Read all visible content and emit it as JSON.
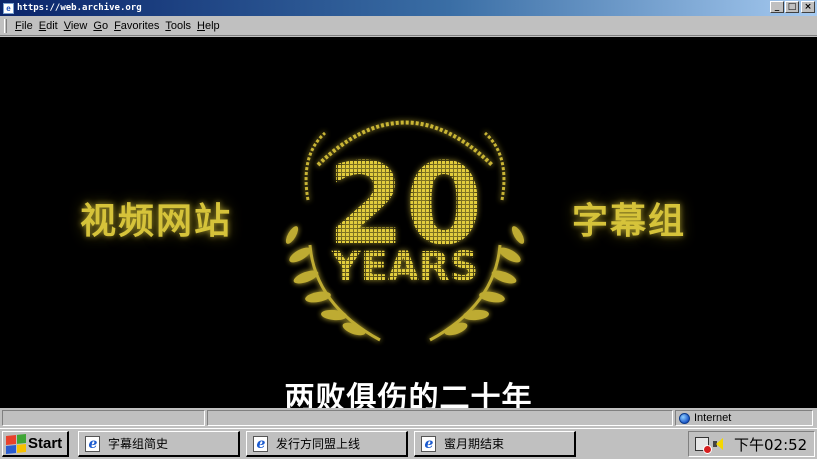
{
  "window": {
    "title": "https://web.archive.org",
    "buttons": {
      "minimize": "_",
      "maximize": "□",
      "close": "×"
    }
  },
  "menu": {
    "items": [
      {
        "label": "File",
        "access": "F",
        "rest": "ile"
      },
      {
        "label": "Edit",
        "access": "E",
        "rest": "dit"
      },
      {
        "label": "View",
        "access": "V",
        "rest": "iew"
      },
      {
        "label": "Go",
        "access": "G",
        "rest": "o"
      },
      {
        "label": "Favorites",
        "access": "F",
        "rest": "avorites"
      },
      {
        "label": "Tools",
        "access": "T",
        "rest": "ools"
      },
      {
        "label": "Help",
        "access": "H",
        "rest": "elp"
      }
    ]
  },
  "video": {
    "left_label": "视频网站",
    "right_label": "字幕组",
    "emblem_number": "20",
    "emblem_word": "YEARS",
    "subtitle": "两败俱伤的二十年",
    "accent_color": "#d6c33a"
  },
  "status": {
    "zone": "Internet"
  },
  "taskbar": {
    "start_label": "Start",
    "tasks": [
      {
        "label": "字幕组简史"
      },
      {
        "label": "发行方同盟上线"
      },
      {
        "label": "蜜月期结束"
      }
    ],
    "clock": "下午02:52"
  }
}
